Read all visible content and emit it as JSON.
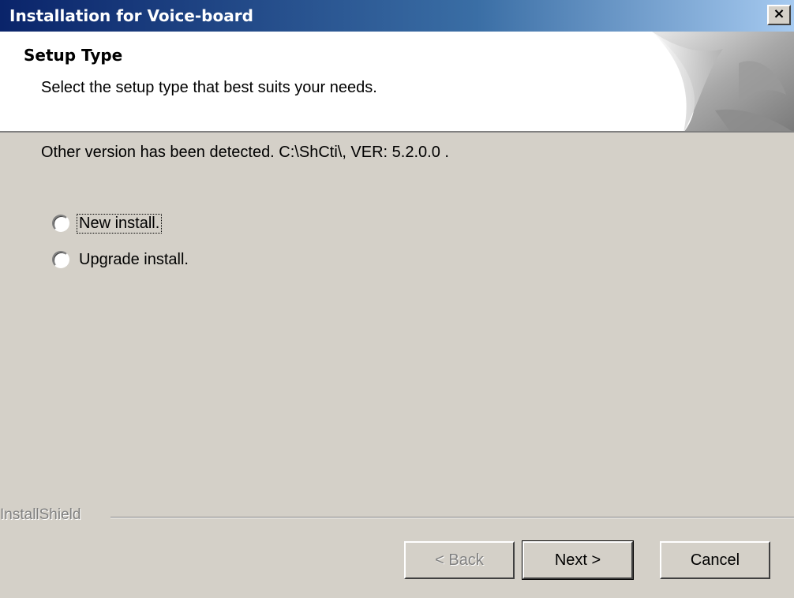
{
  "window": {
    "title": "Installation for Voice-board",
    "close_glyph": "×"
  },
  "header": {
    "title": "Setup Type",
    "subtitle": "Select the setup type that best suits your needs."
  },
  "body": {
    "detected_message": "Other version has been detected. C:\\ShCti\\, VER: 5.2.0.0 .",
    "options": [
      {
        "label": "New install.",
        "selected": false,
        "focused": true
      },
      {
        "label": "Upgrade install.",
        "selected": false,
        "focused": false
      }
    ]
  },
  "footer": {
    "brand": "InstallShield",
    "buttons": {
      "back": "< Back",
      "next": "Next >",
      "cancel": "Cancel"
    },
    "back_enabled": false,
    "default_button": "next"
  },
  "colors": {
    "face": "#d4d0c8",
    "title_start": "#0a246a",
    "title_end": "#a6caf0",
    "disabled_text": "#808080"
  },
  "icons": {
    "close": "close-icon",
    "header_graphic": "curled-page-graphic"
  }
}
